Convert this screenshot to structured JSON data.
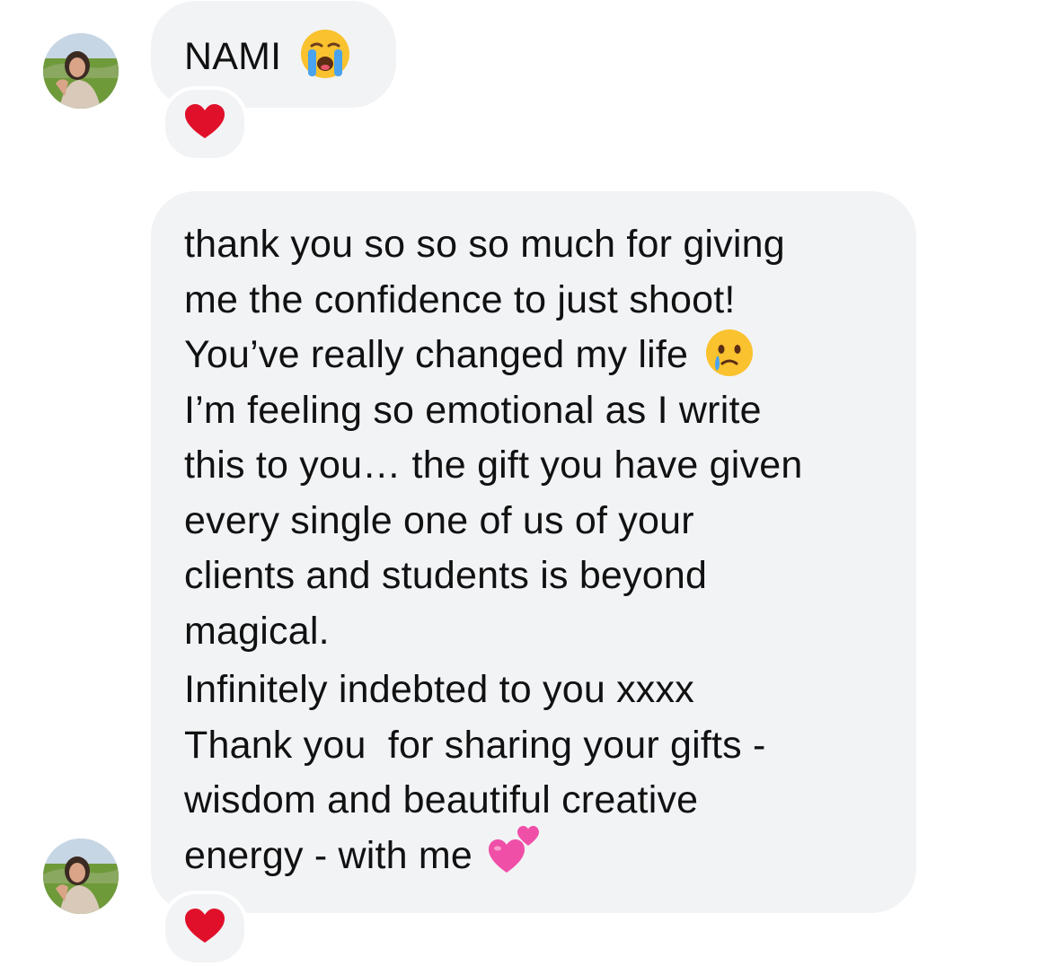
{
  "messages": [
    {
      "text": "NAMI",
      "trailing_emoji": "loudly-crying-face",
      "reaction": "red-heart"
    },
    {
      "lines": [
        "thank you so so so much for giving",
        "me the confidence to just shoot!",
        "You’ve really changed my life",
        "I’m feeling so emotional as I write",
        "this to you… the gift you have given",
        "every single one of us of your",
        "clients and students is beyond",
        "magical.",
        "Infinitely indebted to you xxxx",
        "Thank you  for sharing your gifts -",
        "wisdom and beautiful creative",
        "energy - with me"
      ],
      "inline_emojis": [
        "face-holding-back-tears",
        "two-hearts"
      ],
      "reaction": "red-heart"
    }
  ],
  "colors": {
    "bubble": "#f2f3f5",
    "text": "#111111",
    "heart": "#e0102a",
    "two_hearts": "#f04fa8"
  }
}
